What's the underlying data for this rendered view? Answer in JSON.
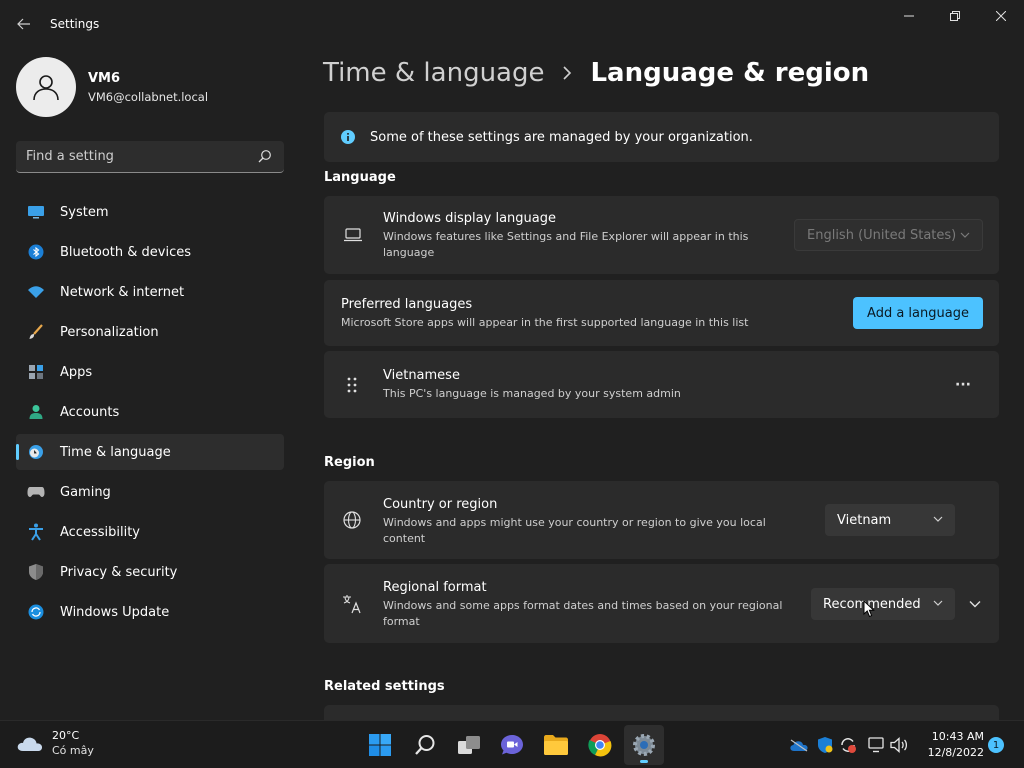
{
  "window": {
    "title": "Settings",
    "back_icon": "arrow-left-icon",
    "controls": [
      "minimize-icon",
      "restore-icon",
      "close-icon"
    ]
  },
  "profile": {
    "name": "VM6",
    "email": "VM6@collabnet.local"
  },
  "search": {
    "placeholder": "Find a setting"
  },
  "sidebar": {
    "items": [
      {
        "label": "System",
        "icon": "monitor-icon",
        "active": false
      },
      {
        "label": "Bluetooth & devices",
        "icon": "bluetooth-icon",
        "active": false
      },
      {
        "label": "Network & internet",
        "icon": "wifi-icon",
        "active": false
      },
      {
        "label": "Personalization",
        "icon": "brush-icon",
        "active": false
      },
      {
        "label": "Apps",
        "icon": "apps-icon",
        "active": false
      },
      {
        "label": "Accounts",
        "icon": "person-icon",
        "active": false
      },
      {
        "label": "Time & language",
        "icon": "clock-globe-icon",
        "active": true
      },
      {
        "label": "Gaming",
        "icon": "gamepad-icon",
        "active": false
      },
      {
        "label": "Accessibility",
        "icon": "accessibility-icon",
        "active": false
      },
      {
        "label": "Privacy & security",
        "icon": "shield-icon",
        "active": false
      },
      {
        "label": "Windows Update",
        "icon": "update-icon",
        "active": false
      }
    ]
  },
  "breadcrumb": {
    "parent": "Time & language",
    "current": "Language & region"
  },
  "info_banner": {
    "text": "Some of these settings are managed by your organization.",
    "icon": "info-icon"
  },
  "language": {
    "header": "Language",
    "display_language": {
      "title": "Windows display language",
      "desc": "Windows features like Settings and File Explorer will appear in this language",
      "value": "English (United States)",
      "icon": "laptop-icon"
    },
    "preferred": {
      "title": "Preferred languages",
      "desc": "Microsoft Store apps will appear in the first supported language in this list",
      "button": "Add a language"
    },
    "vietnamese": {
      "title": "Vietnamese",
      "desc": "This PC's language is managed by your system admin",
      "more": "···",
      "icon": "drag-handle-icon"
    }
  },
  "region": {
    "header": "Region",
    "country": {
      "title": "Country or region",
      "desc": "Windows and apps might use your country or region to give you local content",
      "value": "Vietnam",
      "icon": "globe-icon"
    },
    "format": {
      "title": "Regional format",
      "desc": "Windows and some apps format dates and times based on your regional format",
      "value": "Recommended",
      "icon": "language-format-icon"
    }
  },
  "related": {
    "header": "Related settings"
  },
  "taskbar": {
    "weather_temp": "20°C",
    "weather_desc": "Có mây",
    "time": "10:43 AM",
    "date": "12/8/2022",
    "notification_count": "1",
    "apps": [
      "windows-start-icon",
      "search-icon",
      "task-view-icon",
      "chat-icon",
      "file-explorer-icon",
      "chrome-icon",
      "settings-gear-icon"
    ]
  },
  "colors": {
    "accent": "#4cc2ff",
    "background": "#202020",
    "card": "#2b2b2b"
  }
}
